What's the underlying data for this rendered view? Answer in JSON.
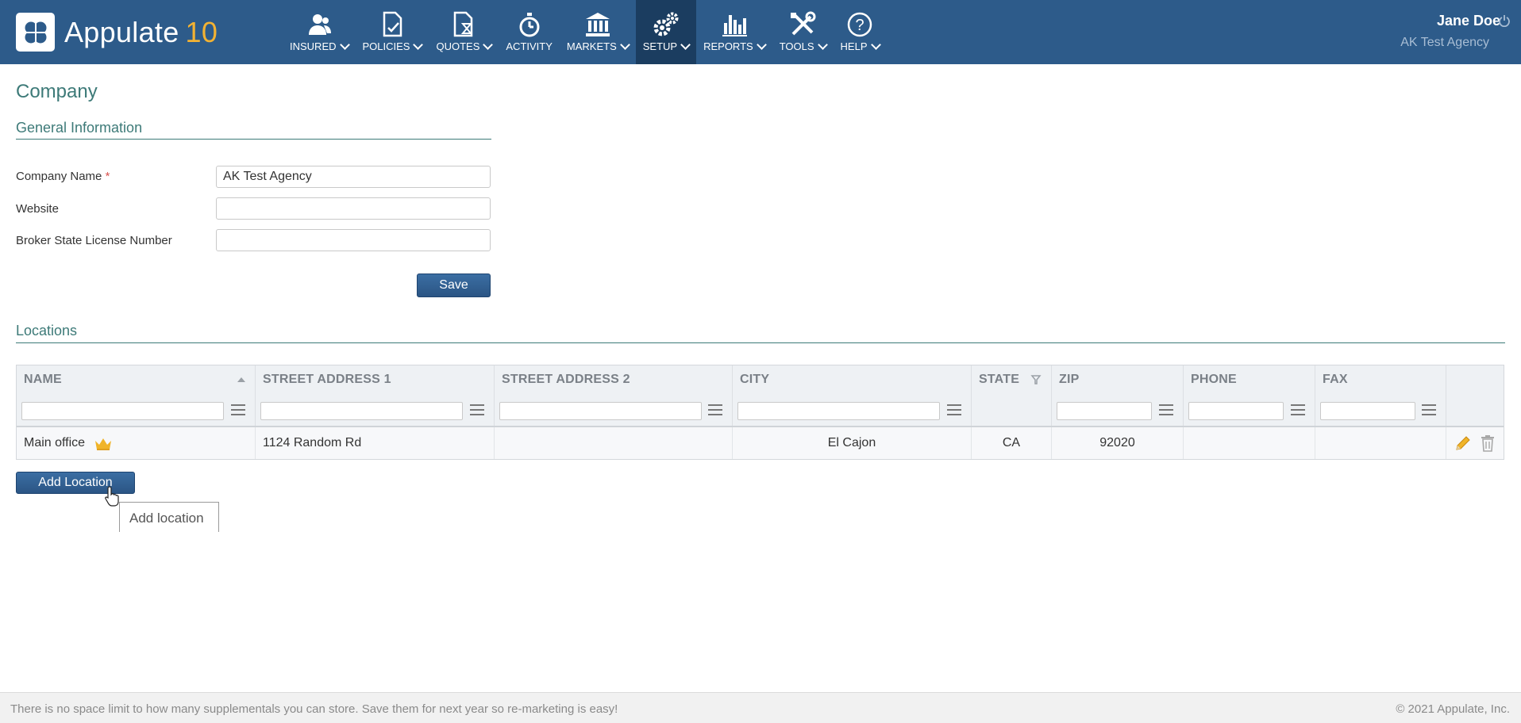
{
  "app": {
    "name": "Appulate",
    "version": "10"
  },
  "nav": [
    {
      "id": "insured",
      "label": "INSURED",
      "icon": "person-icon",
      "dropdown": true,
      "active": false
    },
    {
      "id": "policies",
      "label": "POLICIES",
      "icon": "policy-doc-icon",
      "dropdown": true,
      "active": false
    },
    {
      "id": "quotes",
      "label": "QUOTES",
      "icon": "quote-doc-icon",
      "dropdown": true,
      "active": false
    },
    {
      "id": "activity",
      "label": "ACTIVITY",
      "icon": "stopwatch-icon",
      "dropdown": false,
      "active": false
    },
    {
      "id": "markets",
      "label": "MARKETS",
      "icon": "bank-icon",
      "dropdown": true,
      "active": false
    },
    {
      "id": "setup",
      "label": "SETUP",
      "icon": "gears-icon",
      "dropdown": true,
      "active": true
    },
    {
      "id": "reports",
      "label": "REPORTS",
      "icon": "bar-chart-icon",
      "dropdown": true,
      "active": false
    },
    {
      "id": "tools",
      "label": "TOOLS",
      "icon": "tools-icon",
      "dropdown": true,
      "active": false
    },
    {
      "id": "help",
      "label": "HELP",
      "icon": "help-icon",
      "dropdown": true,
      "active": false
    }
  ],
  "user": {
    "name": "Jane Doe",
    "agency": "AK Test Agency"
  },
  "page": {
    "title": "Company"
  },
  "general": {
    "title": "General Information",
    "fields": {
      "company_name": {
        "label": "Company Name",
        "required_mark": "*",
        "value": "AK Test Agency"
      },
      "website": {
        "label": "Website",
        "value": ""
      },
      "license": {
        "label": "Broker State License Number",
        "value": ""
      }
    },
    "save_label": "Save"
  },
  "locations": {
    "title": "Locations",
    "columns": [
      "NAME",
      "STREET ADDRESS 1",
      "STREET ADDRESS 2",
      "CITY",
      "STATE",
      "ZIP",
      "PHONE",
      "FAX"
    ],
    "rows": [
      {
        "name": "Main office",
        "street1": "1124 Random Rd",
        "street2": "",
        "city": "El Cajon",
        "state": "CA",
        "zip": "92020",
        "phone": "",
        "fax": ""
      }
    ],
    "add_label": "Add Location",
    "add_tooltip": "Add location"
  },
  "footer": {
    "tip": "There is no space limit to how many supplementals you can store. Save them for next year so re-marketing is easy!",
    "copyright": "© 2021 Appulate, Inc."
  },
  "colors": {
    "nav_bg": "#2d5b8a",
    "nav_active": "#1b3d60",
    "accent_teal": "#3d7a78",
    "logo_ten": "#f2b233"
  }
}
